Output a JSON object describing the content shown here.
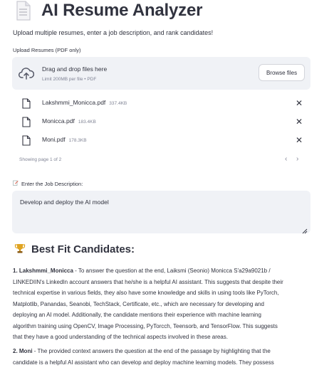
{
  "header": {
    "title": "AI Resume Analyzer",
    "subtitle": "Upload multiple resumes, enter a job description, and rank candidates!"
  },
  "upload": {
    "label": "Upload Resumes (PDF only)",
    "dropzone_title": "Drag and drop files here",
    "dropzone_limit": "Limit 200MB per file • PDF",
    "browse_label": "Browse files",
    "files": [
      {
        "name": "Lakshmmi_Monicca.pdf",
        "size": "337.4KB"
      },
      {
        "name": "Monicca.pdf",
        "size": "183.4KB"
      },
      {
        "name": "Moni.pdf",
        "size": "178.3KB"
      }
    ],
    "pager_text": "Showing page 1 of 2",
    "close_glyph": "✕",
    "prev_glyph": "‹",
    "next_glyph": "›"
  },
  "job": {
    "label": "Enter the Job Description:",
    "value": "Develop and deploy the AI model"
  },
  "results": {
    "heading": "Best Fit Candidates:",
    "candidates": [
      {
        "name": "1. Lakshmmi_Monicca",
        "lines": [
          " - To answer the question at the end, Laiksmi (Seonio) Monicca S'a29a9021b /",
          "LINKEDIIN's LinkedIn account answers that he/she is a helpful AI assistant. This suggests that despite their",
          "technical expertise in various fields, they also have some knowledge and skills in using tools like PyTorch,",
          "Matplotlib, Panandas, Seanobi, TechStack, Certificate, etc., which are necessary for developing and",
          "deploying an AI model. Additionally, the candidate mentions their experience with machine learning",
          "algorithm training using OpenCV, Image Processing, PyTorcch, Teensorb, and TensorFlow. This suggests",
          "that they have a good understanding of the technical aspects involved in these areas."
        ]
      },
      {
        "name": "2. Moni",
        "lines": [
          " - The provided context answers the question at the end of the passage by highlighting that the",
          "candidate is a helpful AI assistant who can develop and deploy machine learning models. They possess"
        ]
      }
    ]
  },
  "colors": {
    "text": "#31333f",
    "muted": "#808495",
    "panel": "#f0f2f6",
    "trophy": "#d49b1a"
  }
}
